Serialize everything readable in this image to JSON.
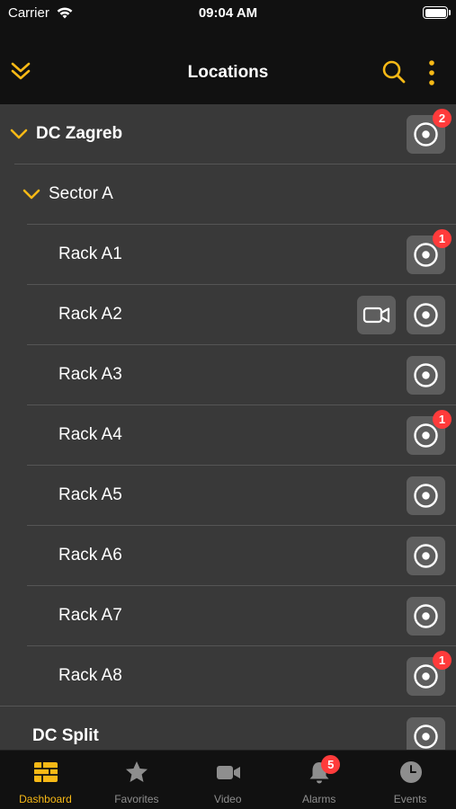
{
  "status": {
    "carrier": "Carrier",
    "time": "09:04 AM"
  },
  "header": {
    "title": "Locations"
  },
  "colors": {
    "accent": "#f7b916",
    "badge": "#ff3b3b",
    "list_bg": "#393939",
    "button_bg": "#5e5e5e"
  },
  "locations": [
    {
      "label": "DC Zagreb",
      "level": 0,
      "expanded": true,
      "badge": "2",
      "camera": false
    },
    {
      "label": "Sector A",
      "level": 1,
      "expanded": true,
      "badge": null,
      "camera": false,
      "no_button": true
    },
    {
      "label": "Rack A1",
      "level": 2,
      "badge": "1",
      "camera": false
    },
    {
      "label": "Rack A2",
      "level": 2,
      "badge": null,
      "camera": true
    },
    {
      "label": "Rack A3",
      "level": 2,
      "badge": null,
      "camera": false
    },
    {
      "label": "Rack A4",
      "level": 2,
      "badge": "1",
      "camera": false
    },
    {
      "label": "Rack A5",
      "level": 2,
      "badge": null,
      "camera": false
    },
    {
      "label": "Rack A6",
      "level": 2,
      "badge": null,
      "camera": false
    },
    {
      "label": "Rack A7",
      "level": 2,
      "badge": null,
      "camera": false
    },
    {
      "label": "Rack A8",
      "level": 2,
      "badge": "1",
      "camera": false
    },
    {
      "label": "DC Split",
      "level": 0,
      "expanded": false,
      "badge": null,
      "camera": false,
      "no_chevron": true
    }
  ],
  "tabs": [
    {
      "label": "Dashboard",
      "icon": "dashboard-grid-icon",
      "active": true,
      "badge": null
    },
    {
      "label": "Favorites",
      "icon": "star-icon",
      "active": false,
      "badge": null
    },
    {
      "label": "Video",
      "icon": "video-camera-icon",
      "active": false,
      "badge": null
    },
    {
      "label": "Alarms",
      "icon": "bell-icon",
      "active": false,
      "badge": "5"
    },
    {
      "label": "Events",
      "icon": "clock-icon",
      "active": false,
      "badge": null
    }
  ]
}
